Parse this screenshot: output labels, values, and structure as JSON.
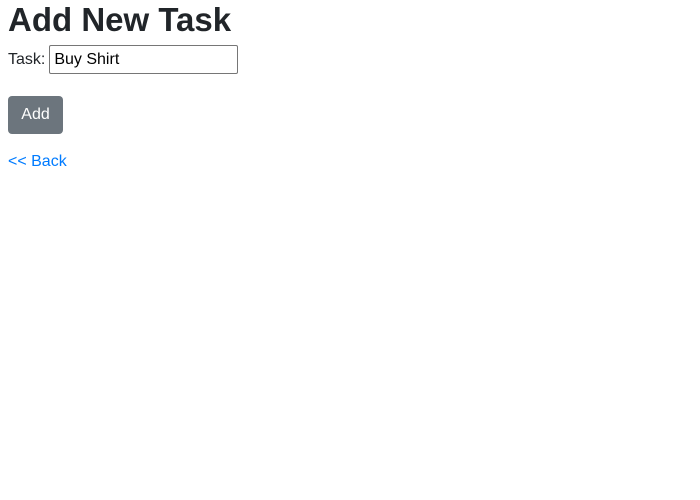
{
  "page": {
    "title": "Add New Task"
  },
  "form": {
    "task_label": "Task:",
    "task_value": "Buy Shirt",
    "add_label": "Add"
  },
  "nav": {
    "back_label": "<< Back"
  },
  "colors": {
    "button_bg": "#6c757d",
    "link": "#007bff",
    "text": "#212529"
  }
}
